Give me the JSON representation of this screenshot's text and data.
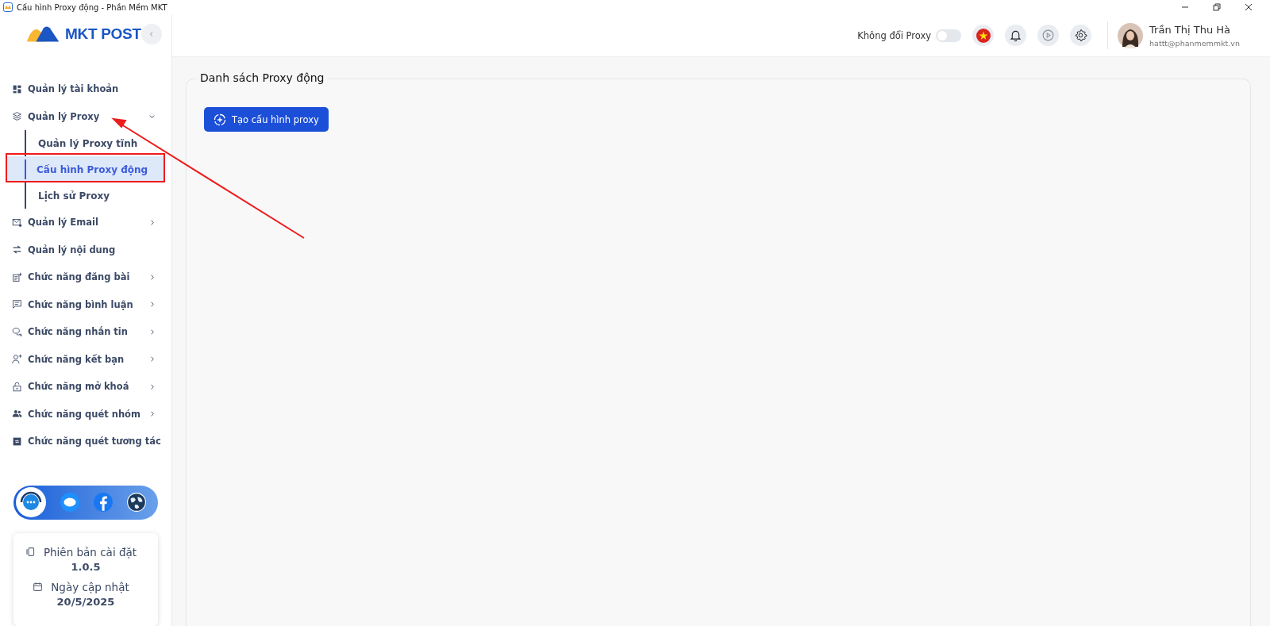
{
  "window": {
    "title": "Cấu hình Proxy động - Phần Mềm MKT"
  },
  "sidebar": {
    "logo": "MKT POST",
    "items": [
      {
        "label": "Quản lý tài khoản",
        "expandable": false,
        "expanded": false
      },
      {
        "label": "Quản lý Proxy",
        "expandable": true,
        "expanded": true,
        "children": [
          {
            "label": "Quản lý Proxy tĩnh",
            "selected": false
          },
          {
            "label": "Cấu hình Proxy động",
            "selected": true
          },
          {
            "label": "Lịch sử Proxy",
            "selected": false
          }
        ]
      },
      {
        "label": "Quản lý Email",
        "expandable": true,
        "expanded": false
      },
      {
        "label": "Quản lý nội dung",
        "expandable": false,
        "expanded": false
      },
      {
        "label": "Chức năng đăng bài",
        "expandable": true,
        "expanded": false
      },
      {
        "label": "Chức năng bình luận",
        "expandable": true,
        "expanded": false
      },
      {
        "label": "Chức năng nhắn tin",
        "expandable": true,
        "expanded": false
      },
      {
        "label": "Chức năng kết bạn",
        "expandable": true,
        "expanded": false
      },
      {
        "label": "Chức năng mở khoá",
        "expandable": true,
        "expanded": false
      },
      {
        "label": "Chức năng quét nhóm",
        "expandable": true,
        "expanded": false
      },
      {
        "label": "Chức năng quét tương tác",
        "expandable": false,
        "expanded": false
      }
    ],
    "version_card": [
      {
        "label": "Phiên bản cài đặt",
        "value": "1.0.5"
      },
      {
        "label": "Ngày cập nhật",
        "value": "20/5/2025"
      }
    ]
  },
  "header": {
    "toggle": {
      "label": "Không đổi Proxy",
      "on": false
    },
    "user": {
      "name": "Trần Thị Thu Hà",
      "email": "hattt@phanmemmkt.vn"
    }
  },
  "panel": {
    "title": "Danh sách Proxy động",
    "button": "Tạo cấu hình proxy"
  }
}
